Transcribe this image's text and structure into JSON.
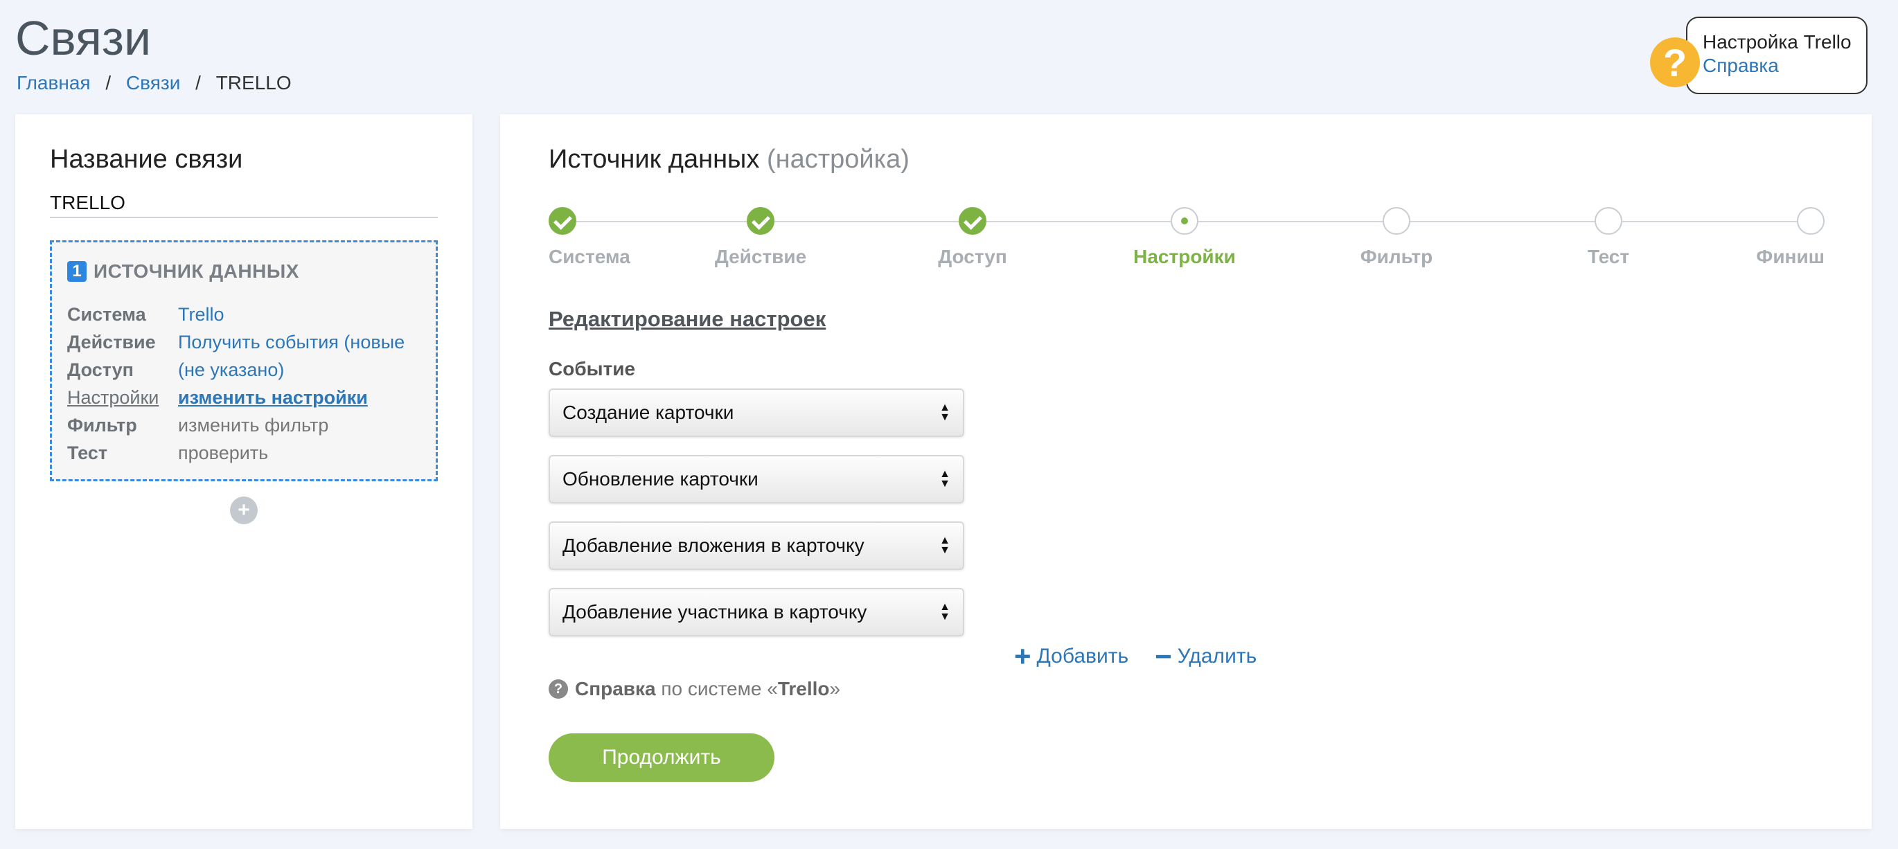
{
  "header": {
    "title": "Связи",
    "breadcrumb": [
      {
        "label": "Главная",
        "link": true
      },
      {
        "label": "Связи",
        "link": true
      },
      {
        "label": "TRELLO",
        "link": false
      }
    ]
  },
  "help_widget": {
    "title": "Настройка Trello",
    "link": "Справка",
    "icon": "question-icon"
  },
  "left_panel": {
    "title": "Название связи",
    "connection_name": "TRELLO",
    "source": {
      "number": "1",
      "title": "ИСТОЧНИК ДАННЫХ",
      "rows": [
        {
          "key": "Система",
          "value": "Trello"
        },
        {
          "key": "Действие",
          "value": "Получить события (новые"
        },
        {
          "key": "Доступ",
          "value": "(не указано)"
        },
        {
          "key": "Настройки",
          "value": "изменить настройки"
        },
        {
          "key": "Фильтр",
          "value": "изменить фильтр"
        },
        {
          "key": "Тест",
          "value": "проверить"
        }
      ]
    },
    "add_symbol": "+"
  },
  "right_panel": {
    "title": "Источник данных",
    "subtitle": "(настройка)",
    "steps": [
      {
        "label": "Система",
        "state": "done"
      },
      {
        "label": "Действие",
        "state": "done"
      },
      {
        "label": "Доступ",
        "state": "done"
      },
      {
        "label": "Настройки",
        "state": "current"
      },
      {
        "label": "Фильтр",
        "state": "pending"
      },
      {
        "label": "Тест",
        "state": "pending"
      },
      {
        "label": "Финиш",
        "state": "pending"
      }
    ],
    "edit_heading": "Редактирование настроек",
    "event_label": "Событие",
    "events": [
      "Создание карточки",
      "Обновление карточки",
      "Добавление вложения в карточку",
      "Добавление участника в карточку"
    ],
    "add_label": "Добавить",
    "remove_label": "Удалить",
    "help_bold": "Справка",
    "help_text": "по системе «",
    "help_system": "Trello",
    "help_close": "»",
    "continue_label": "Продолжить"
  },
  "colors": {
    "accent_green": "#7cb342",
    "link_blue": "#2d76b8",
    "help_yellow": "#f7b733",
    "dashed_blue": "#3c8be0"
  }
}
